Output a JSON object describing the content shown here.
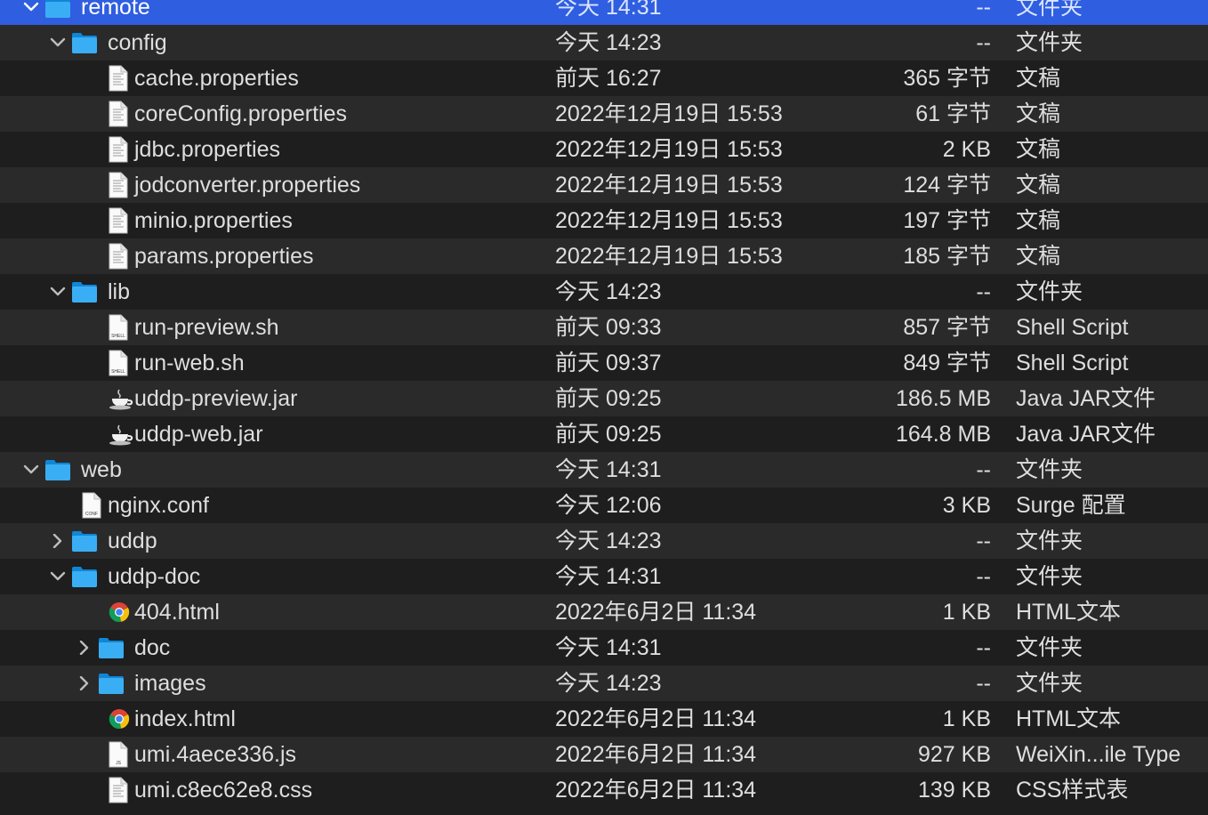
{
  "rows": [
    {
      "name": "remote",
      "date": "今天 14:31",
      "size": "--",
      "kind": "文件夹",
      "depth": 0,
      "type": "folder",
      "expander": "open",
      "selected": true
    },
    {
      "name": "config",
      "date": "今天 14:23",
      "size": "--",
      "kind": "文件夹",
      "depth": 1,
      "type": "folder",
      "expander": "open"
    },
    {
      "name": "cache.properties",
      "date": "前天 16:27",
      "size": "365 字节",
      "kind": "文稿",
      "depth": 2,
      "type": "doc"
    },
    {
      "name": "coreConfig.properties",
      "date": "2022年12月19日 15:53",
      "size": "61 字节",
      "kind": "文稿",
      "depth": 2,
      "type": "doc"
    },
    {
      "name": "jdbc.properties",
      "date": "2022年12月19日 15:53",
      "size": "2 KB",
      "kind": "文稿",
      "depth": 2,
      "type": "doc"
    },
    {
      "name": "jodconverter.properties",
      "date": "2022年12月19日 15:53",
      "size": "124 字节",
      "kind": "文稿",
      "depth": 2,
      "type": "doc"
    },
    {
      "name": "minio.properties",
      "date": "2022年12月19日 15:53",
      "size": "197 字节",
      "kind": "文稿",
      "depth": 2,
      "type": "doc"
    },
    {
      "name": "params.properties",
      "date": "2022年12月19日 15:53",
      "size": "185 字节",
      "kind": "文稿",
      "depth": 2,
      "type": "doc"
    },
    {
      "name": "lib",
      "date": "今天 14:23",
      "size": "--",
      "kind": "文件夹",
      "depth": 1,
      "type": "folder",
      "expander": "open"
    },
    {
      "name": "run-preview.sh",
      "date": "前天 09:33",
      "size": "857 字节",
      "kind": "Shell Script",
      "depth": 2,
      "type": "shell"
    },
    {
      "name": "run-web.sh",
      "date": "前天 09:37",
      "size": "849 字节",
      "kind": "Shell Script",
      "depth": 2,
      "type": "shell"
    },
    {
      "name": "uddp-preview.jar",
      "date": "前天 09:25",
      "size": "186.5 MB",
      "kind": "Java JAR文件",
      "depth": 2,
      "type": "jar"
    },
    {
      "name": "uddp-web.jar",
      "date": "前天 09:25",
      "size": "164.8 MB",
      "kind": "Java JAR文件",
      "depth": 2,
      "type": "jar"
    },
    {
      "name": "web",
      "date": "今天 14:31",
      "size": "--",
      "kind": "文件夹",
      "depth": 0,
      "type": "folder",
      "expander": "open"
    },
    {
      "name": "nginx.conf",
      "date": "今天 12:06",
      "size": "3 KB",
      "kind": "Surge 配置",
      "depth": 1,
      "type": "conf"
    },
    {
      "name": "uddp",
      "date": "今天 14:23",
      "size": "--",
      "kind": "文件夹",
      "depth": 1,
      "type": "folder",
      "expander": "closed"
    },
    {
      "name": "uddp-doc",
      "date": "今天 14:31",
      "size": "--",
      "kind": "文件夹",
      "depth": 1,
      "type": "folder",
      "expander": "open"
    },
    {
      "name": "404.html",
      "date": "2022年6月2日 11:34",
      "size": "1 KB",
      "kind": "HTML文本",
      "depth": 2,
      "type": "html"
    },
    {
      "name": "doc",
      "date": "今天 14:31",
      "size": "--",
      "kind": "文件夹",
      "depth": 2,
      "type": "folder",
      "expander": "closed"
    },
    {
      "name": "images",
      "date": "今天 14:23",
      "size": "--",
      "kind": "文件夹",
      "depth": 2,
      "type": "folder",
      "expander": "closed"
    },
    {
      "name": "index.html",
      "date": "2022年6月2日 11:34",
      "size": "1 KB",
      "kind": "HTML文本",
      "depth": 2,
      "type": "html"
    },
    {
      "name": "umi.4aece336.js",
      "date": "2022年6月2日 11:34",
      "size": "927 KB",
      "kind": "WeiXin...ile Type",
      "depth": 2,
      "type": "js"
    },
    {
      "name": "umi.c8ec62e8.css",
      "date": "2022年6月2日 11:34",
      "size": "139 KB",
      "kind": "CSS样式表",
      "depth": 2,
      "type": "css"
    }
  ],
  "colors": {
    "selection": "#2f5ee0",
    "folder": "#1a9bf0",
    "stripe_dark": "#1e1e1e",
    "stripe_light": "#2a2a2a",
    "text": "#dedede",
    "secondary_text": "#c8c8c8"
  },
  "icons": {
    "folder": "folder-icon",
    "doc": "document-icon",
    "shell": "shell-script-icon",
    "jar": "java-jar-icon",
    "conf": "config-file-icon",
    "html": "chrome-html-icon",
    "js": "js-file-icon",
    "css": "css-file-icon",
    "expander_open": "chevron-down-icon",
    "expander_closed": "chevron-right-icon"
  }
}
